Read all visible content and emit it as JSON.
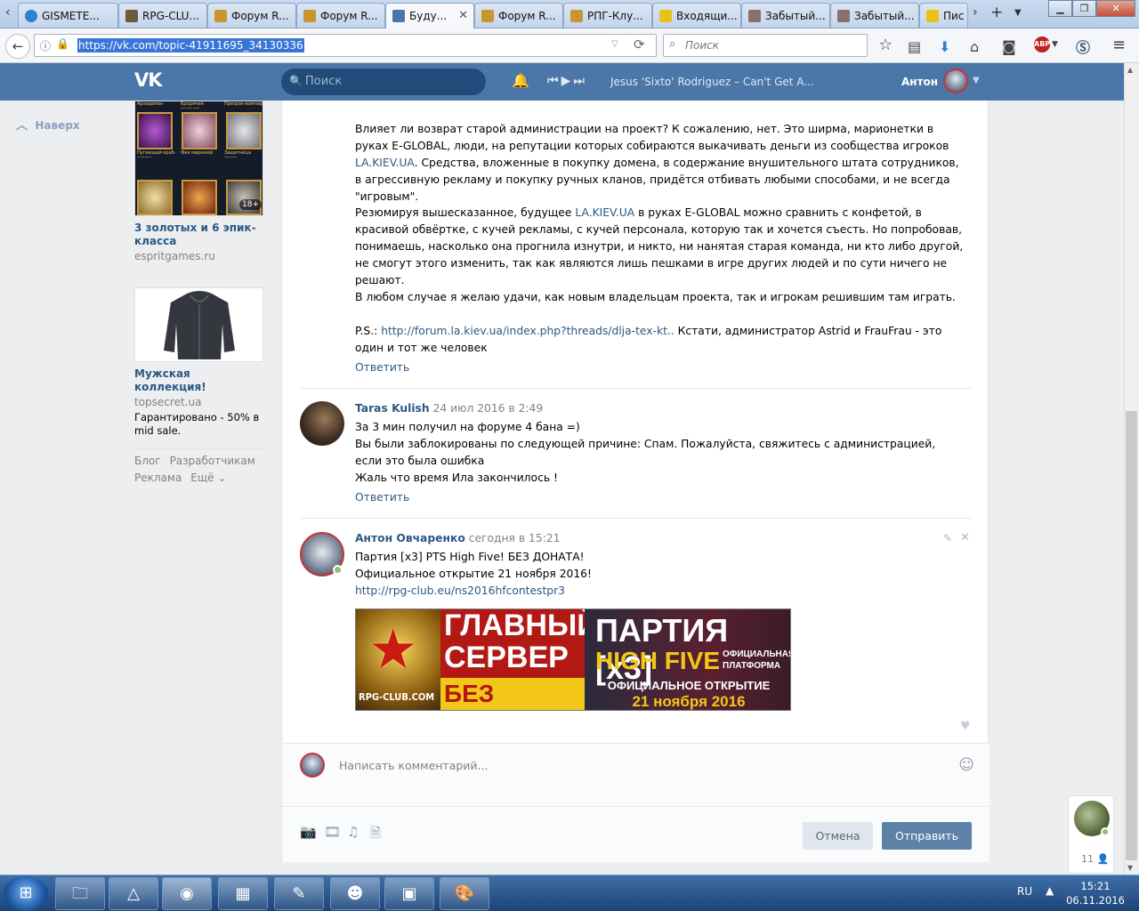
{
  "browser": {
    "tabs": [
      {
        "label": "GISMETE...",
        "icon_color": "#2f80d1"
      },
      {
        "label": "RPG-CLU...",
        "icon_color": "#6b5a3b"
      },
      {
        "label": "Форум R...",
        "icon_color": "#c9962d"
      },
      {
        "label": "Форум R...",
        "icon_color": "#c9962d"
      },
      {
        "label": "Буду...",
        "icon_color": "#4a76a8"
      },
      {
        "label": "Форум R...",
        "icon_color": "#c9962d"
      },
      {
        "label": "РПГ-Клу...",
        "icon_color": "#c9962d"
      },
      {
        "label": "Входящи...",
        "icon_color": "#e8c21b"
      },
      {
        "label": "Забытый...",
        "icon_color": "#8a6f6a"
      },
      {
        "label": "Забытый...",
        "icon_color": "#8a6f6a"
      },
      {
        "label": "Пис",
        "icon_color": "#e8c21b"
      }
    ],
    "url": "https://vk.com/topic-41911695_34130336",
    "search_placeholder": "Поиск",
    "abp_label": "ABP"
  },
  "vk_header": {
    "logo": "VK",
    "search_placeholder": "Поиск",
    "track": "Jesus 'Sixto' Rodriguez – Can't Get A...",
    "user_name": "Антон"
  },
  "sidebar": {
    "to_top": "Наверх",
    "ads": [
      {
        "title": "3 золотых и 6 эпик-класса",
        "domain": "espritgames.ru",
        "thumb_labels": [
          "Архидемон",
          "Бродячий охотник",
          "Призрак-вампир",
          "Пугающий краб-демон",
          "Фея миражей",
          "Защитница света"
        ],
        "age_badge": "18+"
      },
      {
        "title": "Мужская коллекция!",
        "domain": "topsecret.ua",
        "desc": "Гарантировано - 50% в mid sale."
      }
    ],
    "links": [
      "Блог",
      "Разработчикам",
      "Реклама",
      "Ещё ⌄"
    ]
  },
  "post_top": {
    "para1_a": "Влияет ли возврат старой администрации на проект? К сожалению, нет. Это ширма, марионетки в руках E-GLOBAL, люди, на репутации которых собираются выкачивать деньги из сообщества игроков ",
    "para1_link": "LA.KIEV.UA",
    "para1_b": ". Средства, вложенные в покупку домена, в содержание внушительного штата сотрудников, в агрессивную рекламу и покупку ручных кланов, придётся отбивать любыми способами, и не всегда \"игровым\".",
    "para2_a": "Резюмируя вышесказанное, будущее ",
    "para2_link": "LA.KIEV.UA",
    "para2_b": " в руках E-GLOBAL можно сравнить с конфетой, в красивой обвёртке, с кучей рекламы, с кучей персонала, которую так и хочется съесть. Но попробовав, понимаешь, насколько она прогнила изнутри, и никто, ни нанятая старая команда, ни кто либо другой, не смогут этого изменить, так как являются лишь пешками в игре других людей и по сути ничего не решают.",
    "para3": "В любом случае я желаю удачи, как новым владельцам проекта, так и игрокам решившим там играть.",
    "ps_prefix": "P.S.: ",
    "ps_link": "http://forum.la.kiev.ua/index.php?threads/dlja-tex-kt..",
    "ps_suffix": " Кстати, администратор Astrid и FrauFrau - это один и тот же человек",
    "reply": "Ответить"
  },
  "comment_taras": {
    "author": "Taras Kulish",
    "date": "24 июл 2016 в 2:49",
    "line1": "За 3 мин получил на форуме 4 бана =)",
    "line2": "Вы были заблокированы по следующей причине: Спам. Пожалуйста, свяжитесь с администрацией, если это была ошибка",
    "line3": "Жаль что время Ила закончилось !",
    "reply": "Ответить"
  },
  "comment_anton": {
    "author": "Антон Овчаренко",
    "date": "сегодня в 15:21",
    "line1": "Партия [x3] PTS High Five! БЕЗ ДОНАТА!",
    "line2": "Официальное открытие 21 ноября 2016!",
    "link": "http://rpg-club.eu/ns2016hfcontestpr3",
    "banner": {
      "site": "RPG-CLUB.COM",
      "main1": "ГЛАВНЫЙ",
      "main2": "СЕРВЕР",
      "nodonate": "БЕЗ ДОНАТА",
      "party": "ПАРТИЯ [x3]",
      "highfive": "HIGH FIVE",
      "platform": "ОФИЦИАЛЬНАЯ ПЛАТФОРМА",
      "opening": "ОФИЦИАЛЬНОЕ ОТКРЫТИЕ",
      "date": "21 ноября 2016"
    }
  },
  "comment_form": {
    "placeholder": "Написать комментарий...",
    "cancel": "Отмена",
    "send": "Отправить"
  },
  "chat_widget": {
    "count": "11"
  },
  "taskbar": {
    "lang": "RU",
    "time": "15:21",
    "date": "06.11.2016"
  }
}
